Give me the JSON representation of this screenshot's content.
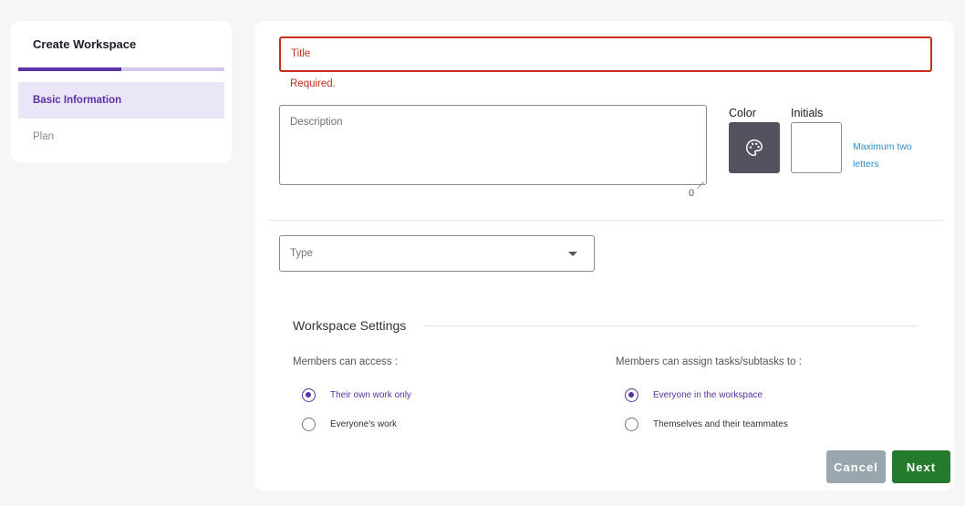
{
  "sidebar": {
    "title": "Create Workspace",
    "progress": 0.5,
    "steps": [
      {
        "label": "Basic Information",
        "active": true
      },
      {
        "label": "Plan",
        "active": false
      }
    ]
  },
  "form": {
    "title_label": "Title",
    "title_error": "Required.",
    "description_label": "Description",
    "description_count": "0",
    "color_label": "Color",
    "color_value": "#55525f",
    "color_icon": "palette-icon",
    "initials_label": "Initials",
    "initials_hint": "Maximum two letters",
    "type_label": "Type"
  },
  "settings": {
    "title": "Workspace Settings",
    "access": {
      "label": "Members can access :",
      "options": [
        {
          "label": "Their own work only",
          "selected": true
        },
        {
          "label": "Everyone's work",
          "selected": false
        }
      ]
    },
    "assign": {
      "label": "Members can assign tasks/subtasks to :",
      "options": [
        {
          "label": "Everyone in the workspace",
          "selected": true
        },
        {
          "label": "Themselves and their teammates",
          "selected": false
        }
      ]
    }
  },
  "actions": {
    "cancel_label": "Cancel",
    "next_label": "Next"
  },
  "colors": {
    "accent": "#5a32a3",
    "error": "#c6301c",
    "primary_button": "#247a2d",
    "secondary_button": "#98a6ad"
  }
}
